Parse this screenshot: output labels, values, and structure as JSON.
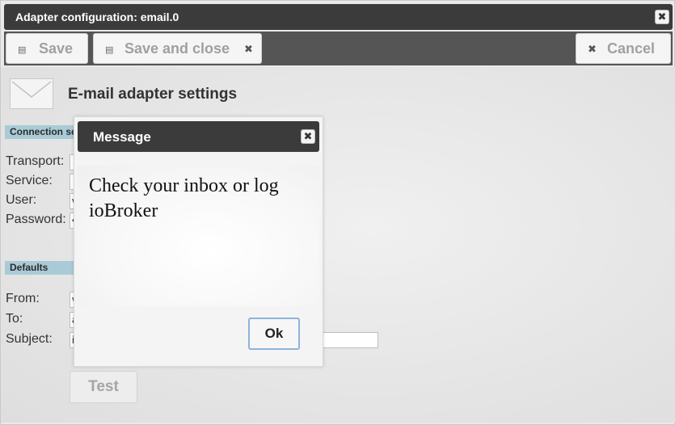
{
  "window": {
    "title": "Adapter configuration: email.0"
  },
  "toolbar": {
    "save": "Save",
    "save_close": "Save and close",
    "cancel": "Cancel"
  },
  "page": {
    "title": "E-mail adapter settings"
  },
  "sections": {
    "connection": "Connection se",
    "defaults": "Defaults"
  },
  "fields": {
    "transport": {
      "label": "Transport:",
      "value": ""
    },
    "service": {
      "label": "Service:",
      "value": ""
    },
    "user": {
      "label": "User:",
      "value": "v"
    },
    "password": {
      "label": "Password:",
      "value": "•"
    },
    "from": {
      "label": "From:",
      "value": "v"
    },
    "to": {
      "label": "To:",
      "value": "a"
    },
    "subject": {
      "label": "Subject:",
      "value": "i"
    }
  },
  "test_button": "Test",
  "dialog": {
    "title": "Message",
    "message": "Check your inbox or log ioBroker",
    "ok": "Ok"
  }
}
